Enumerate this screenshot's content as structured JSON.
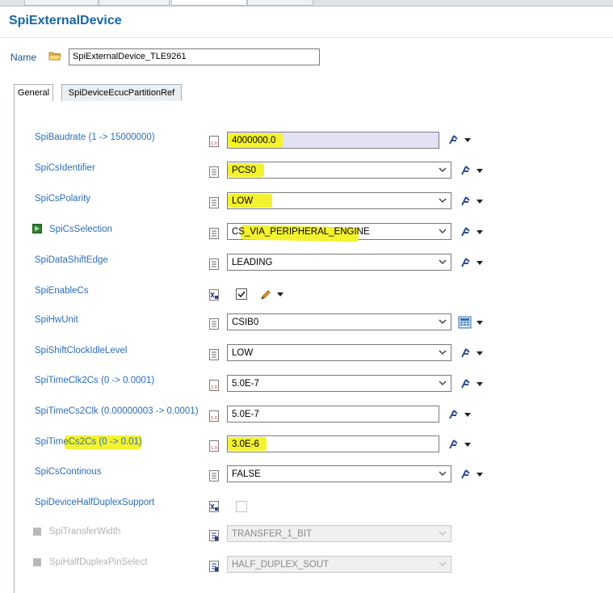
{
  "editor": {
    "title": "SpiExternalDevice",
    "name_label": "Name",
    "name_value": "SpiExternalDevice_TLE9261"
  },
  "tabs": [
    {
      "label": "General",
      "active": true
    },
    {
      "label": "SpiDeviceEcucPartitionRef",
      "active": false
    }
  ],
  "fields": [
    {
      "label": "SpiBaudrate (1 -> 15000000)",
      "value": "4000000.0",
      "type": "number"
    },
    {
      "label": "SpiCsIdentifier",
      "value": "PCS0",
      "type": "enum"
    },
    {
      "label": "SpiCsPolarity",
      "value": "LOW",
      "type": "enum"
    },
    {
      "label": "SpiCsSelection",
      "value": "CS_VIA_PERIPHERAL_ENGINE",
      "type": "enum"
    },
    {
      "label": "SpiDataShiftEdge",
      "value": "LEADING",
      "type": "enum"
    },
    {
      "label": "SpiEnableCs",
      "checked": true,
      "type": "checkbox"
    },
    {
      "label": "SpiHwUnit",
      "value": "CSIB0",
      "type": "enum"
    },
    {
      "label": "SpiShiftClockIdleLevel",
      "value": "LOW",
      "type": "enum"
    },
    {
      "label": "SpiTimeClk2Cs (0 -> 0.0001)",
      "value": "5.0E-7",
      "type": "number-enum"
    },
    {
      "label": "SpiTimeCs2Clk (0.00000003 -> 0.0001)",
      "value": "5.0E-7",
      "type": "number"
    },
    {
      "label": "SpiTimeCs2Cs (0 -> 0.01)",
      "value": "3.0E-6",
      "type": "number"
    },
    {
      "label": "SpiCsContinous",
      "value": "FALSE",
      "type": "enum"
    },
    {
      "label": "SpiDeviceHalfDuplexSupport",
      "checked": false,
      "type": "checkbox"
    },
    {
      "label": "SpiTransferWidth",
      "value": "TRANSFER_1_BIT",
      "type": "enum",
      "disabled": true
    },
    {
      "label": "SpiHalfDuplexPinSelect",
      "value": "HALF_DUPLEX_SOUT",
      "type": "enum",
      "disabled": true
    }
  ],
  "colors": {
    "title": "#1565a8",
    "label": "#2b6db7",
    "highlight": "#f3f22f",
    "disabled_text": "#b4b4b4"
  },
  "icons": [
    "folder-icon",
    "number-param-icon",
    "enum-param-icon",
    "boolean-param-icon",
    "reference-param-icon",
    "action-menu-icon",
    "edit-pencil-icon",
    "calculator-icon",
    "chevron-down-icon",
    "enabled-toggle-icon"
  ]
}
